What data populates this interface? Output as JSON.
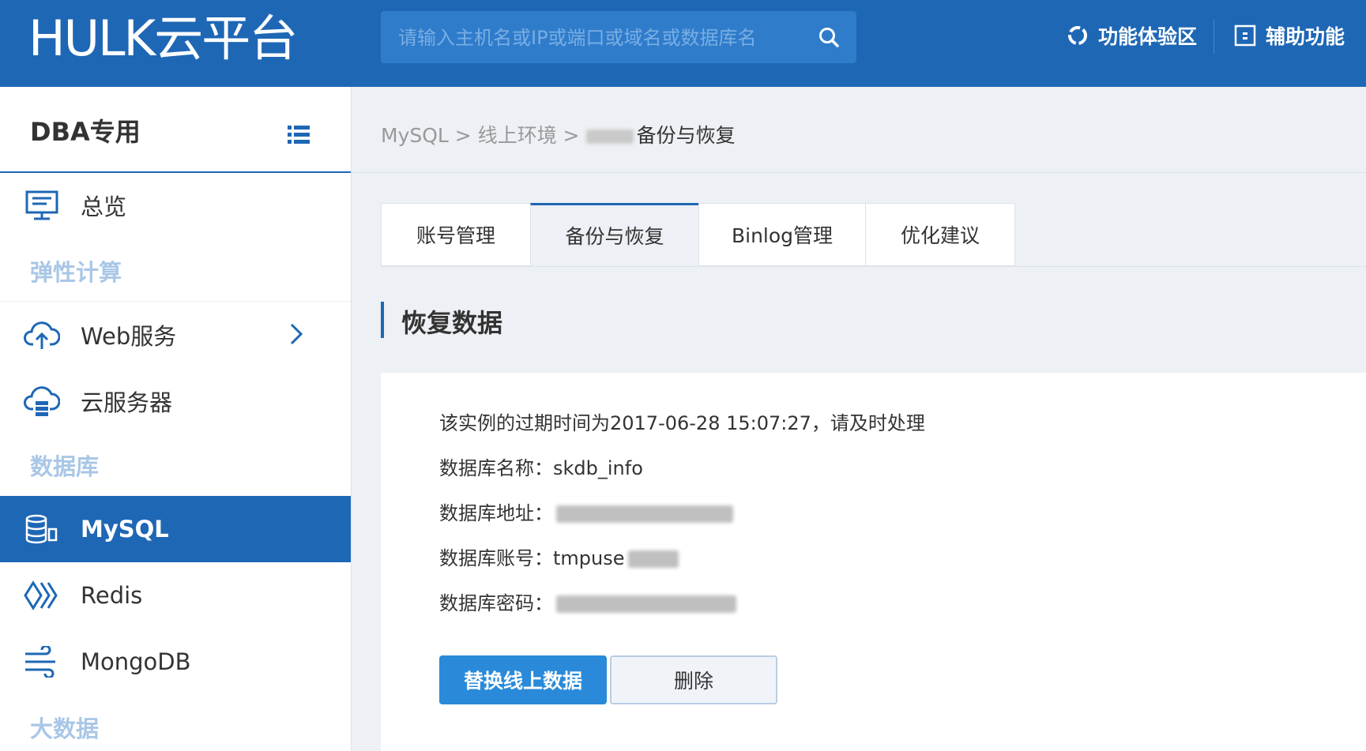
{
  "header": {
    "logo": "HULK云平台",
    "search_placeholder": "请输入主机名或IP或端口或域名或数据库名",
    "actions": [
      {
        "label": "功能体验区",
        "icon": "lab-icon"
      },
      {
        "label": "辅助功能",
        "icon": "accessibility-icon"
      }
    ]
  },
  "sidebar": {
    "title": "DBA专用",
    "items": [
      {
        "label": "总览",
        "icon": "monitor-icon"
      },
      {
        "section": "弹性计算"
      },
      {
        "label": "Web服务",
        "icon": "cloud-upload-icon",
        "has_chevron": true
      },
      {
        "label": "云服务器",
        "icon": "cloud-server-icon"
      },
      {
        "section": "数据库"
      },
      {
        "label": "MySQL",
        "icon": "database-icon",
        "active": true
      },
      {
        "label": "Redis",
        "icon": "redis-icon"
      },
      {
        "label": "MongoDB",
        "icon": "mongodb-icon"
      },
      {
        "section": "大数据"
      }
    ]
  },
  "breadcrumb": {
    "items": [
      "MySQL",
      "线上环境"
    ],
    "separator": ">",
    "current": "备份与恢复"
  },
  "tabs": [
    {
      "label": "账号管理",
      "active": false
    },
    {
      "label": "备份与恢复",
      "active": true
    },
    {
      "label": "Binlog管理",
      "active": false
    },
    {
      "label": "优化建议",
      "active": false
    }
  ],
  "section_title": "恢复数据",
  "info": {
    "expire_notice": "该实例的过期时间为2017-06-28 15:07:27，请及时处理",
    "db_name_label": "数据库名称：",
    "db_name_value": "skdb_info",
    "db_addr_label": "数据库地址：",
    "db_account_label": "数据库账号：",
    "db_account_value": "tmpuse",
    "db_password_label": "数据库密码："
  },
  "buttons": {
    "replace": "替换线上数据",
    "delete": "删除"
  },
  "colors": {
    "brand": "#1e67b5",
    "primary_button": "#2a8ad9",
    "section_label": "#a9c7e6"
  }
}
